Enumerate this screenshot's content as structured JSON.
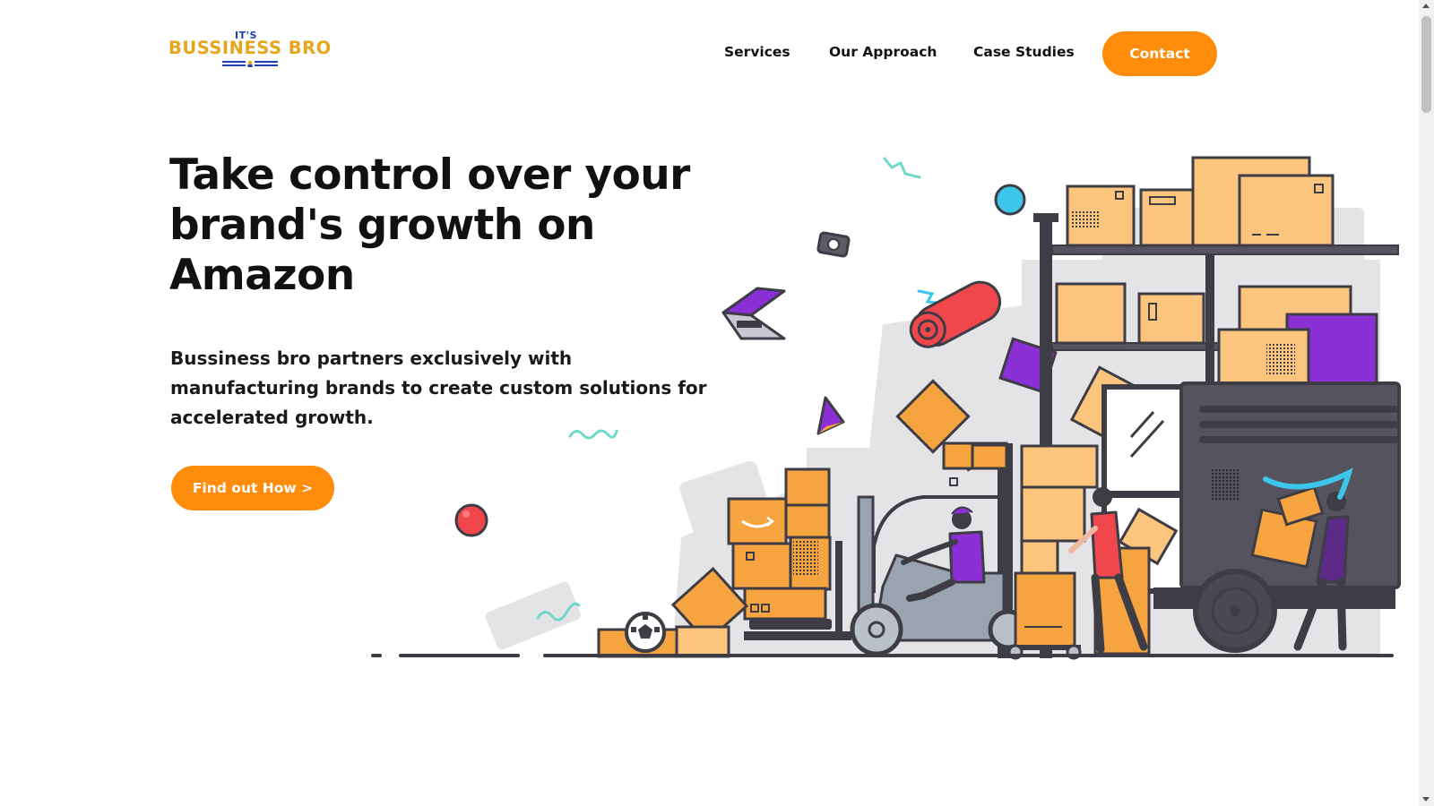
{
  "header": {
    "logo": {
      "top_text": "IT'S",
      "main_text": "BUSSINESS BRO"
    },
    "nav": {
      "services": "Services",
      "approach": "Our Approach",
      "case_studies": "Case Studies",
      "contact": "Contact"
    }
  },
  "hero": {
    "title": "Take control over your brand's growth on Amazon",
    "subtitle": "Bussiness bro partners exclusively with manufacturing brands to create custom solutions for accelerated growth.",
    "cta": "Find out How >"
  },
  "colors": {
    "accent": "#ff8c0a",
    "logo_gold": "#e6a51b",
    "logo_blue": "#1e3fb5",
    "box_orange": "#f5a440",
    "purple": "#8b2fd6",
    "dark": "#3e3c45",
    "teal": "#6fd8c8",
    "red": "#f0474c",
    "cyan": "#3cc6ea"
  },
  "illustration": {
    "subject": "warehouse-logistics-scene"
  }
}
